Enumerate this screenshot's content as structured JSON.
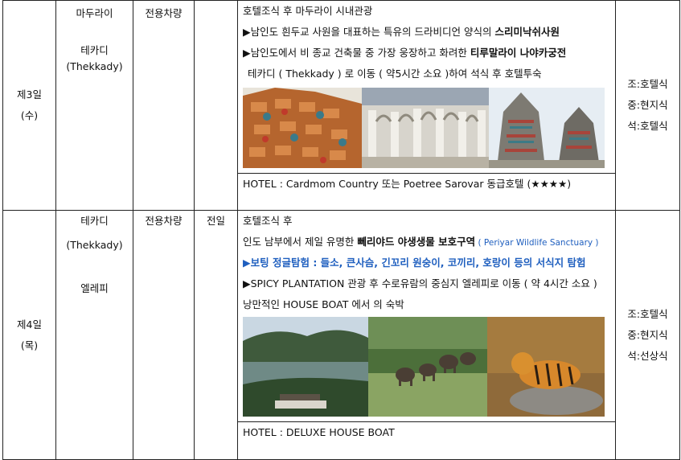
{
  "day3": {
    "day": "제3일",
    "weekday": "(수)",
    "cities": [
      "마두라이",
      "테카디",
      "(Thekkady)"
    ],
    "transport": "전용차량",
    "meal_col": "",
    "lines": [
      {
        "text": "호텔조식 후 마두라이 시내관광"
      },
      {
        "prefix": "▶남인도 흰두교 사원을 대표하는 특유의 드라비디언 양식의 ",
        "bold": "스리미낙쉬사원"
      },
      {
        "prefix": "▶남인도에서 비 종교 건축물 중 가장 웅장하고 화려한 ",
        "bold": "티루말라이 나야카궁전"
      },
      {
        "text": "테카디 ( Thekkady ) 로 이동 ( 약5시간 소요 )하여 석식 후 호텔투숙"
      }
    ],
    "photos": [
      "temple-gopuram-photo",
      "palace-hall-photo",
      "temple-tower-photo"
    ],
    "hotel": "HOTEL :   Cardmom Country  또는 Poetree Sarovar 동급호텔 (★★★★)",
    "meals": [
      "조:호텔식",
      "중:현지식",
      "석:호텔식"
    ]
  },
  "day4": {
    "day": "제4일",
    "weekday": "(목)",
    "cities": [
      "테카디",
      "(Thekkady)",
      "엘레피"
    ],
    "transport": "전용차량",
    "meal_col": "전일",
    "line1": "호텔조식 후",
    "line2_prefix": "인도 남부에서 제일 유명한 ",
    "line2_bold": "뻬리야드 야생생물 보호구역",
    "line2_en": " ( Periyar Wildlife Sanctuary )",
    "line3": "▶보팅 정글탐험 : 들소, 큰사슴, 긴꼬리 원숭이, 코끼리, 호랑이 등의 서식지 탐험",
    "line4": "▶SPICY PLANTATION 관광 후 수로유람의 중심지 엘레피로 이동 ( 약 4시간 소요 )",
    "line5": "낭만적인 HOUSE BOAT 에서 의 숙박",
    "photos": [
      "lake-boat-photo",
      "elephants-photo",
      "tiger-photo"
    ],
    "hotel": "HOTEL :   DELUXE HOUSE BOAT",
    "meals": [
      "조:호텔식",
      "중:현지식",
      "석:선상식"
    ]
  }
}
